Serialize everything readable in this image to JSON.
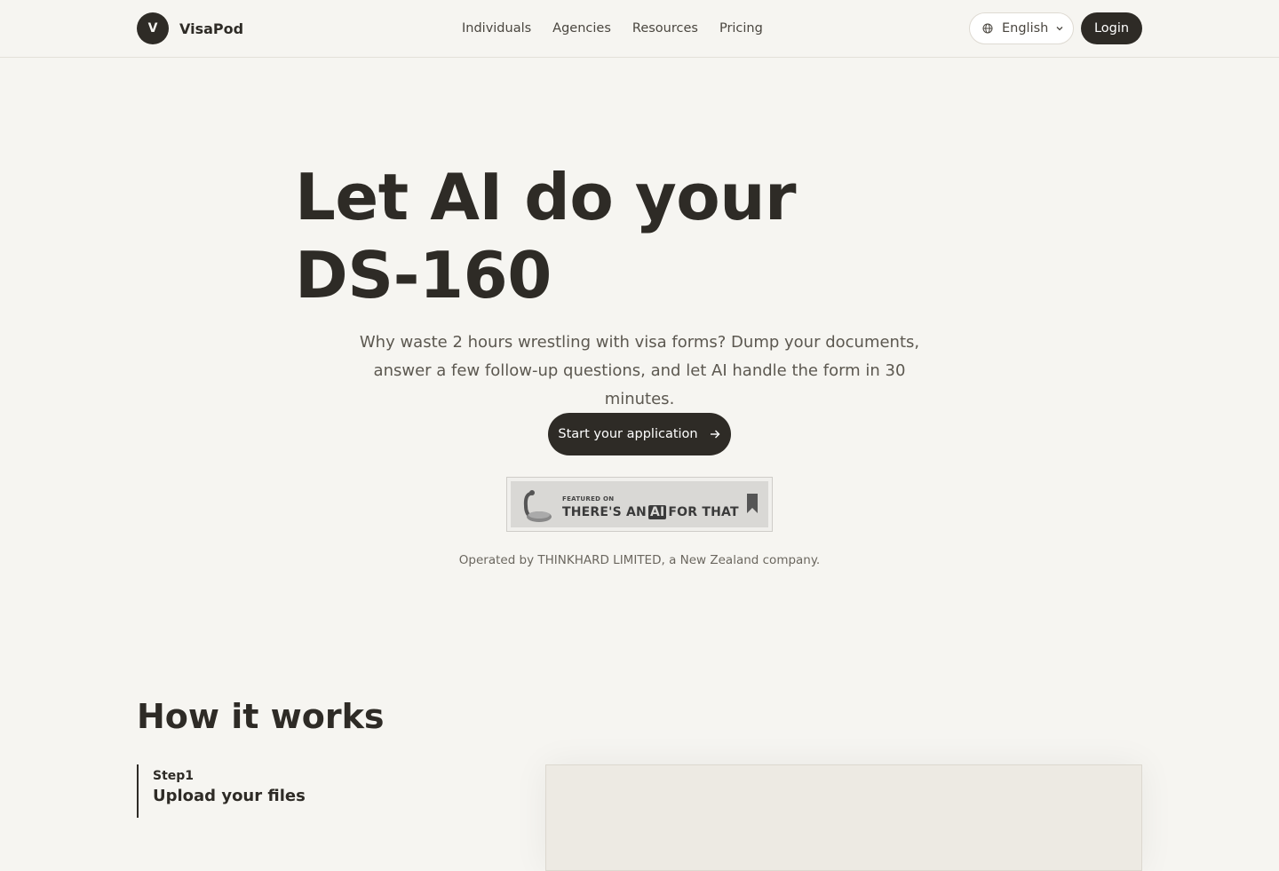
{
  "header": {
    "logo_letter": "V",
    "brand": "VisaPod",
    "nav": [
      "Individuals",
      "Agencies",
      "Resources",
      "Pricing"
    ],
    "language": "English",
    "login": "Login"
  },
  "hero": {
    "title_line1": "Let AI do your",
    "title_line2": "DS-160",
    "subtitle": "Why waste 2 hours wrestling with visa forms? Dump your documents, answer a few follow-up questions, and let AI handle the form in 30 minutes.",
    "cta": "Start your application",
    "badge_small": "FEATURED ON",
    "badge_big_before": "THERE'S AN",
    "badge_big_ai": "AI",
    "badge_big_after": "FOR THAT",
    "operated": "Operated by THINKHARD LIMITED, a New Zealand company."
  },
  "how": {
    "title": "How it works",
    "step_label": "Step1",
    "step_title": "Upload your files"
  },
  "icons": {
    "globe": "globe-icon",
    "chevron": "chevron-down-icon",
    "arrow": "arrow-right-icon",
    "bookmark": "bookmark-icon"
  },
  "colors": {
    "background": "#f6f5f1",
    "primary": "#2e2b26"
  }
}
